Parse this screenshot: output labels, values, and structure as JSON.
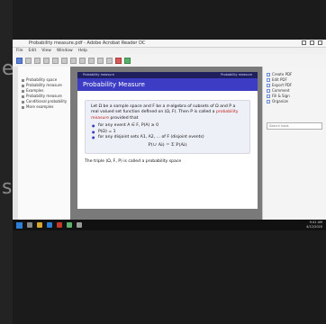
{
  "ghost": {
    "char1": "e",
    "char2": "s"
  },
  "window": {
    "title": "Probability measure.pdf - Adobe Acrobat Reader DC"
  },
  "menu": [
    "File",
    "Edit",
    "View",
    "Window",
    "Help"
  ],
  "bookmarks": [
    "Probability space",
    "Probability measure",
    "Examples",
    "Probability measure",
    "Conditional probability",
    "More examples"
  ],
  "slide": {
    "header_left": "Probability measure",
    "header_right": "Probability measure",
    "title": "Probability Measure",
    "intro_a": "Let ",
    "intro_b": " be a sample space and F be a σ-algebra of subsets of Ω and P a real valued set function defined on (Ω, F). Then P is called a ",
    "intro_hl": "probability measure",
    "intro_c": " provided that",
    "items": [
      "for any event A ∈ F, P(A) ≥ 0",
      "P(Ω) = 1",
      "for any disjoint sets A1, A2, ... of F (disjoint events)"
    ],
    "formula": "P(∪ Ai) = Σ P(Ai)",
    "tail": "The triple (Ω, F, P) is called a probability space"
  },
  "right_tools": [
    "Create PDF",
    "Edit PDF",
    "Export PDF",
    "Comment",
    "Fill & Sign",
    "Organize"
  ],
  "search_placeholder": "Search tools",
  "clock": {
    "time": "9:41 AM",
    "date": "4/12/2020"
  }
}
